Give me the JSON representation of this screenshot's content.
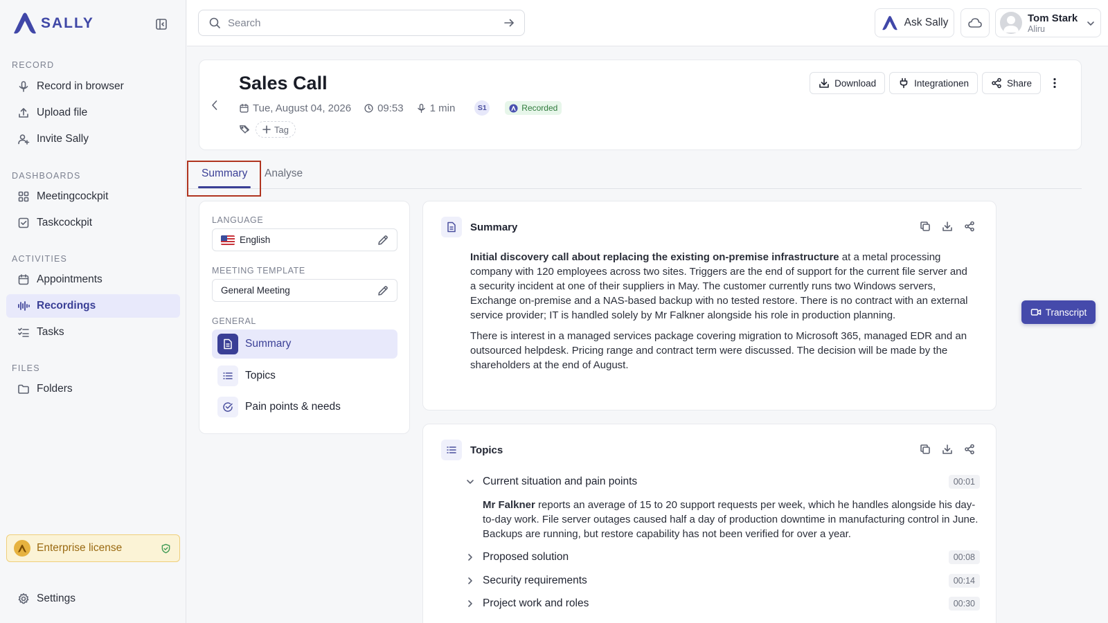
{
  "app": {
    "name": "SALLY"
  },
  "sidebar": {
    "sections": [
      {
        "title": "RECORD",
        "items": [
          {
            "label": "Record in browser",
            "icon": "microphone-icon"
          },
          {
            "label": "Upload file",
            "icon": "upload-icon"
          },
          {
            "label": "Invite Sally",
            "icon": "user-plus-icon"
          }
        ]
      },
      {
        "title": "DASHBOARDS",
        "items": [
          {
            "label": "Meetingcockpit",
            "icon": "grid-icon"
          },
          {
            "label": "Taskcockpit",
            "icon": "checkbox-icon"
          }
        ]
      },
      {
        "title": "ACTIVITIES",
        "items": [
          {
            "label": "Appointments",
            "icon": "calendar-icon"
          },
          {
            "label": "Recordings",
            "icon": "waveform-icon",
            "active": true
          },
          {
            "label": "Tasks",
            "icon": "task-list-icon"
          }
        ]
      },
      {
        "title": "FILES",
        "items": [
          {
            "label": "Folders",
            "icon": "folder-icon"
          }
        ]
      }
    ],
    "license": "Enterprise license",
    "settings": "Settings"
  },
  "header": {
    "search_placeholder": "Search",
    "ask_sally": "Ask Sally",
    "user": {
      "name": "Tom Stark",
      "org": "Aliru"
    }
  },
  "meeting": {
    "title": "Sales Call",
    "date": "Tue, August 04, 2026",
    "time": "09:53",
    "duration": "1 min",
    "speaker": "S1",
    "status": "Recorded",
    "add_tag": "Tag",
    "actions": {
      "download": "Download",
      "integrations": "Integrationen",
      "share": "Share"
    }
  },
  "tabs": {
    "summary": "Summary",
    "analyse": "Analyse",
    "active": "summary"
  },
  "settings_panel": {
    "language_label": "LANGUAGE",
    "language_value": "English",
    "template_label": "MEETING TEMPLATE",
    "template_value": "General Meeting",
    "general_label": "GENERAL",
    "items": [
      "Summary",
      "Topics",
      "Pain points & needs"
    ]
  },
  "summary_card": {
    "title": "Summary",
    "p1_bold": "Initial discovery call about replacing the existing on-premise infrastructure",
    "p1_rest": " at a metal processing company with 120 employees across two sites. Triggers are the end of support for the current file server and a security incident at one of their suppliers in May. The customer currently runs two Windows servers, Exchange on-premise and a NAS-based backup with no tested restore. There is no contract with an external service provider; IT is handled solely by Mr Falkner alongside his role in production planning.",
    "p2": "There is interest in a managed services package covering migration to Microsoft 365, managed EDR and an outsourced helpdesk. Pricing range and contract term were discussed. The decision will be made by the shareholders at the end of August."
  },
  "topics_card": {
    "title": "Topics",
    "items": [
      {
        "label": "Current situation and pain points",
        "time": "00:01",
        "expanded": true
      },
      {
        "label": "Proposed solution",
        "time": "00:08"
      },
      {
        "label": "Security requirements",
        "time": "00:14"
      },
      {
        "label": "Project work and roles",
        "time": "00:30"
      }
    ],
    "expanded_bold": "Mr Falkner",
    "expanded_text": " reports an average of 15 to 20 support requests per week, which he handles alongside his day-to-day work. File server outages caused half a day of production downtime in manufacturing control in June. Backups are running, but restore capability has not been verified for over a year."
  },
  "transcript_button": "Transcript",
  "colors": {
    "accent": "#3a3f96",
    "active_bg": "#e8e9fb",
    "license_bg": "#fbf3d6",
    "recorded_green": "#2f7a3c",
    "highlight_border": "#b0341f"
  }
}
